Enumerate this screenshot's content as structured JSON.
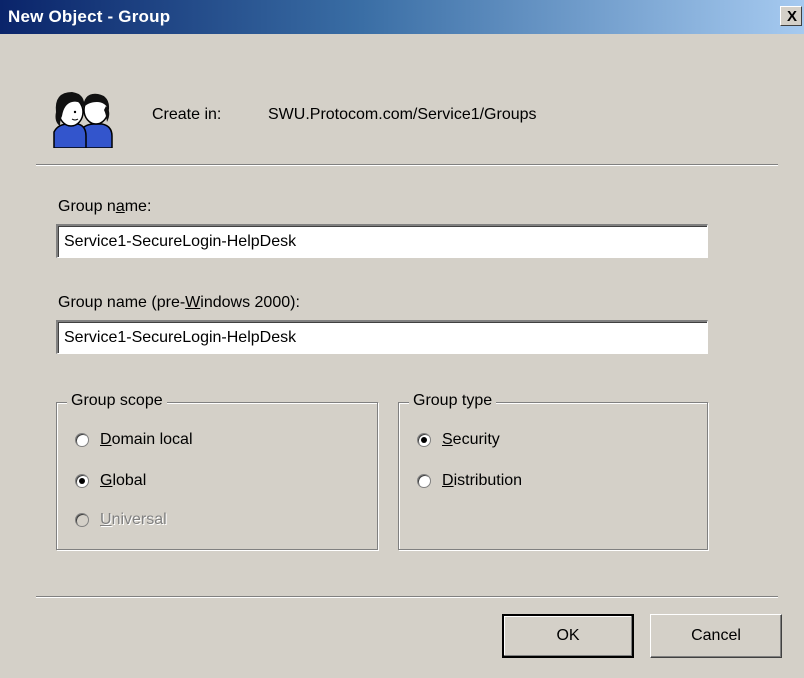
{
  "window": {
    "title": "New Object - Group",
    "close_glyph": "X"
  },
  "header": {
    "icon": "group-users-icon",
    "create_in_label": "Create in:",
    "create_in_path": "SWU.Protocom.com/Service1/Groups"
  },
  "fields": {
    "group_name": {
      "label_pre": "Group n",
      "label_mnemonic": "a",
      "label_post": "me:",
      "value": "Service1-SecureLogin-HelpDesk"
    },
    "group_name_legacy": {
      "label_pre": "Group name (pre-",
      "label_mnemonic": "W",
      "label_post": "indows 2000):",
      "value": "Service1-SecureLogin-HelpDesk"
    }
  },
  "group_scope": {
    "title": "Group scope",
    "options": [
      {
        "mnemonic": "D",
        "rest": "omain local",
        "checked": false,
        "disabled": false
      },
      {
        "mnemonic": "G",
        "rest": "lobal",
        "checked": true,
        "disabled": false
      },
      {
        "mnemonic": "U",
        "rest": "niversal",
        "checked": false,
        "disabled": true
      }
    ]
  },
  "group_type": {
    "title": "Group type",
    "options": [
      {
        "mnemonic": "S",
        "rest": "ecurity",
        "checked": true,
        "disabled": false
      },
      {
        "mnemonic": "D",
        "rest": "istribution",
        "checked": false,
        "disabled": false
      }
    ]
  },
  "buttons": {
    "ok_label": "OK",
    "cancel_label": "Cancel"
  },
  "colors": {
    "title_gradient_start": "#0a246a",
    "title_gradient_end": "#a6caf0",
    "face": "#d4d0c8"
  }
}
